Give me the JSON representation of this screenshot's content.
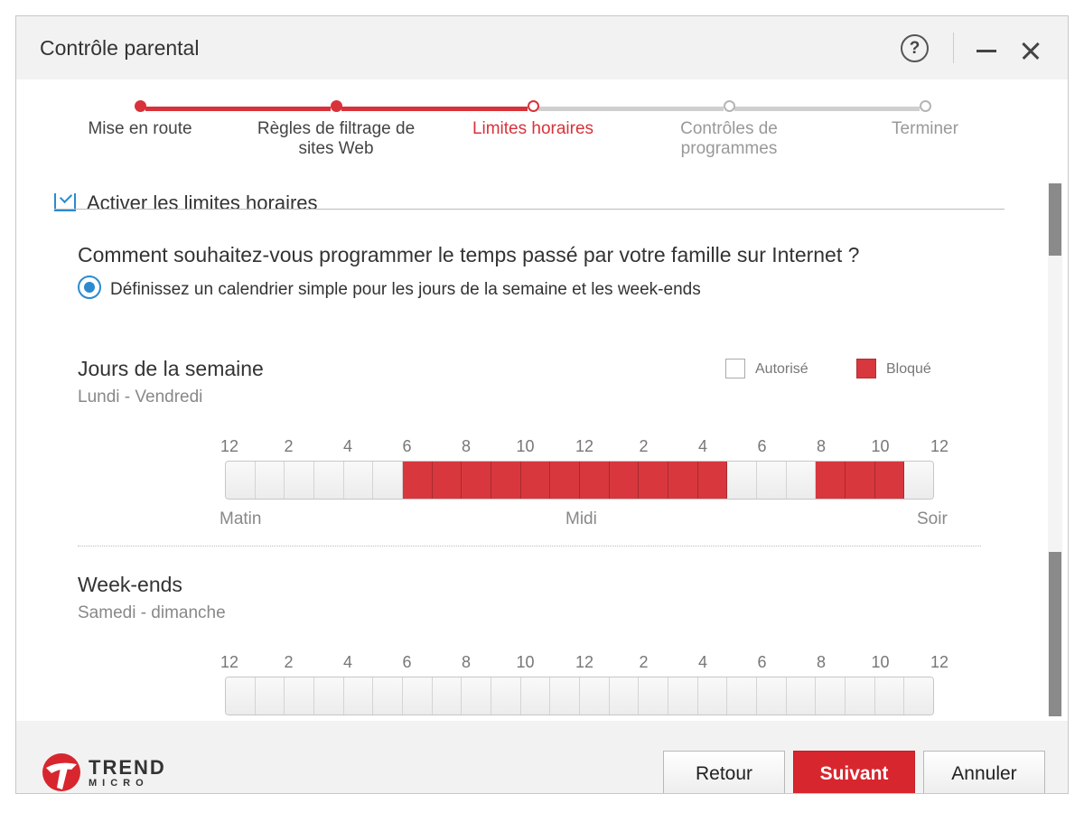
{
  "window": {
    "title": "Contrôle parental",
    "help_glyph": "?"
  },
  "stepper": {
    "steps": [
      {
        "label": "Mise en route",
        "state": "done"
      },
      {
        "label": "Règles de filtrage de sites Web",
        "state": "done"
      },
      {
        "label": "Limites horaires",
        "state": "current"
      },
      {
        "label": "Contrôles de programmes",
        "state": "todo"
      },
      {
        "label": "Terminer",
        "state": "todo"
      }
    ],
    "colors": {
      "active": "#d8323a",
      "inactive": "#cfcfcf"
    }
  },
  "content": {
    "enable_label": "Activer les limites horaires",
    "enabled": true,
    "question": "Comment souhaitez-vous programmer le temps passé par votre famille sur Internet ?",
    "radio_label": "Définissez un calendrier simple pour les jours de la semaine et les week-ends",
    "legend": {
      "allowed": "Autorisé",
      "blocked": "Bloqué"
    },
    "hour_ticks": [
      "12",
      "2",
      "4",
      "6",
      "8",
      "10",
      "12",
      "2",
      "4",
      "6",
      "8",
      "10",
      "12"
    ],
    "period_labels": {
      "morning": "Matin",
      "noon": "Midi",
      "evening": "Soir"
    },
    "weekdays": {
      "title": "Jours de la semaine",
      "subtitle": "Lundi - Vendredi",
      "blocked_slots": [
        6,
        7,
        8,
        9,
        10,
        11,
        12,
        13,
        14,
        15,
        16,
        20,
        21,
        22
      ]
    },
    "weekends": {
      "title": "Week-ends",
      "subtitle": "Samedi - dimanche",
      "blocked_slots": []
    },
    "slot_count": 24
  },
  "footer": {
    "logo_line1": "TREND",
    "logo_line2": "MICRO",
    "back_label": "Retour",
    "next_label": "Suivant",
    "cancel_label": "Annuler"
  }
}
